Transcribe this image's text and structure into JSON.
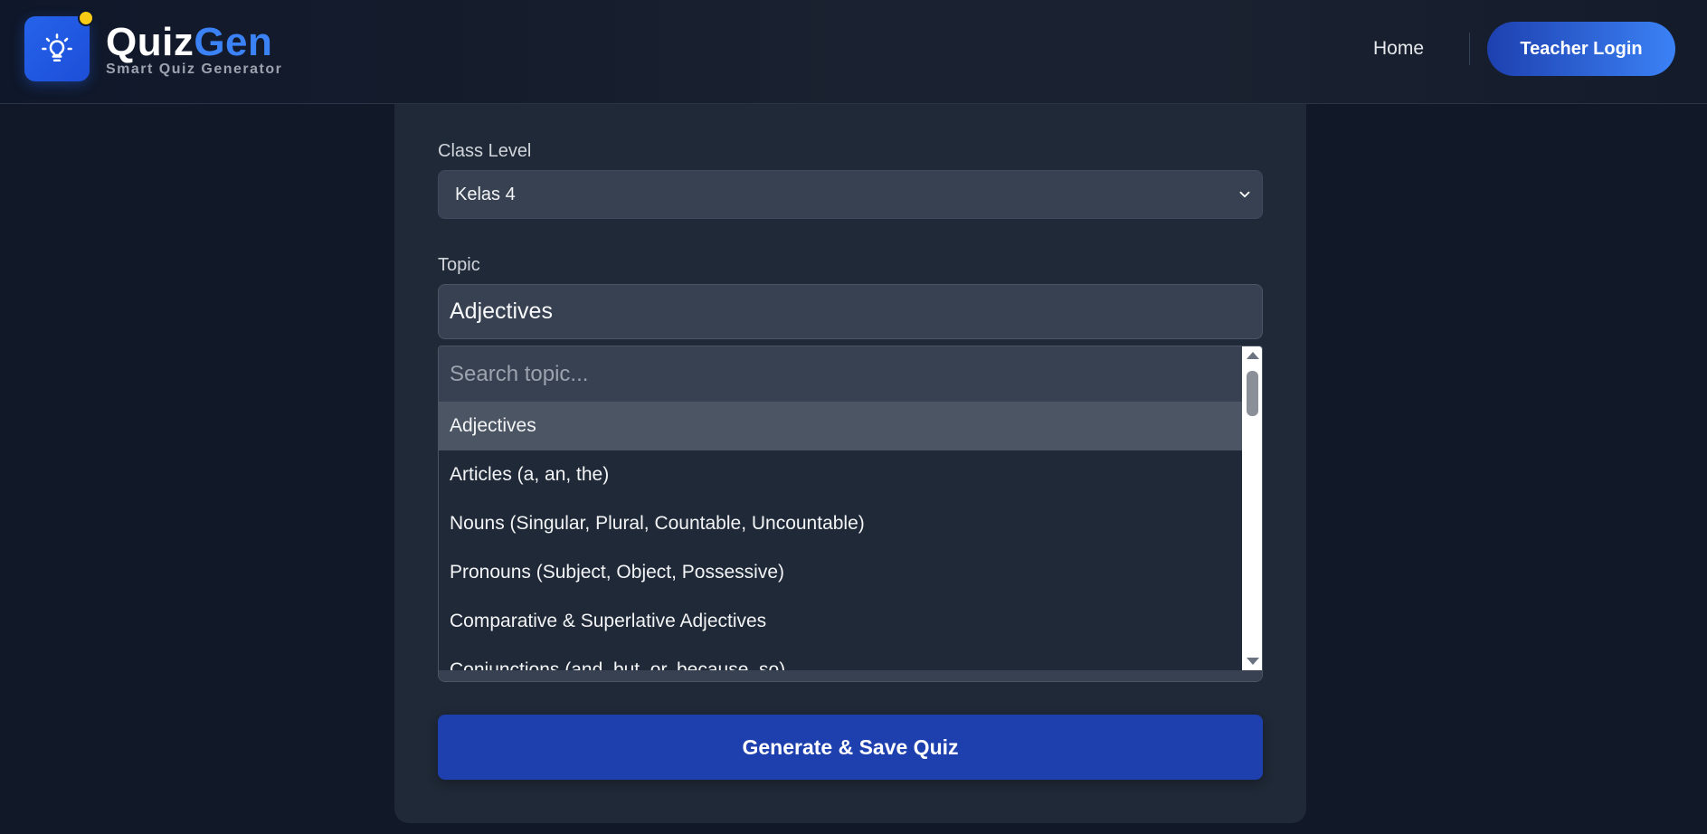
{
  "header": {
    "brand_part1": "Quiz",
    "brand_part2": "Gen",
    "tagline": "Smart Quiz Generator",
    "nav_home": "Home",
    "login_label": "Teacher Login"
  },
  "form": {
    "class_level_label": "Class Level",
    "class_level_value": "Kelas 4",
    "topic_label": "Topic",
    "topic_value": "Adjectives",
    "search_placeholder": "Search topic...",
    "topics": [
      "Adjectives",
      "Articles (a, an, the)",
      "Nouns (Singular, Plural, Countable, Uncountable)",
      "Pronouns (Subject, Object, Possessive)",
      "Comparative & Superlative Adjectives",
      "Conjunctions (and, but, or, because, so)"
    ],
    "generate_label": "Generate & Save Quiz"
  },
  "colors": {
    "accent": "#2563eb",
    "brand_blue": "#3b82f6",
    "notification_dot": "#facc15",
    "background": "#111827",
    "card": "#1f2937"
  },
  "icons": {
    "logo": "lightbulb-icon",
    "select": "chevron-down-icon"
  }
}
